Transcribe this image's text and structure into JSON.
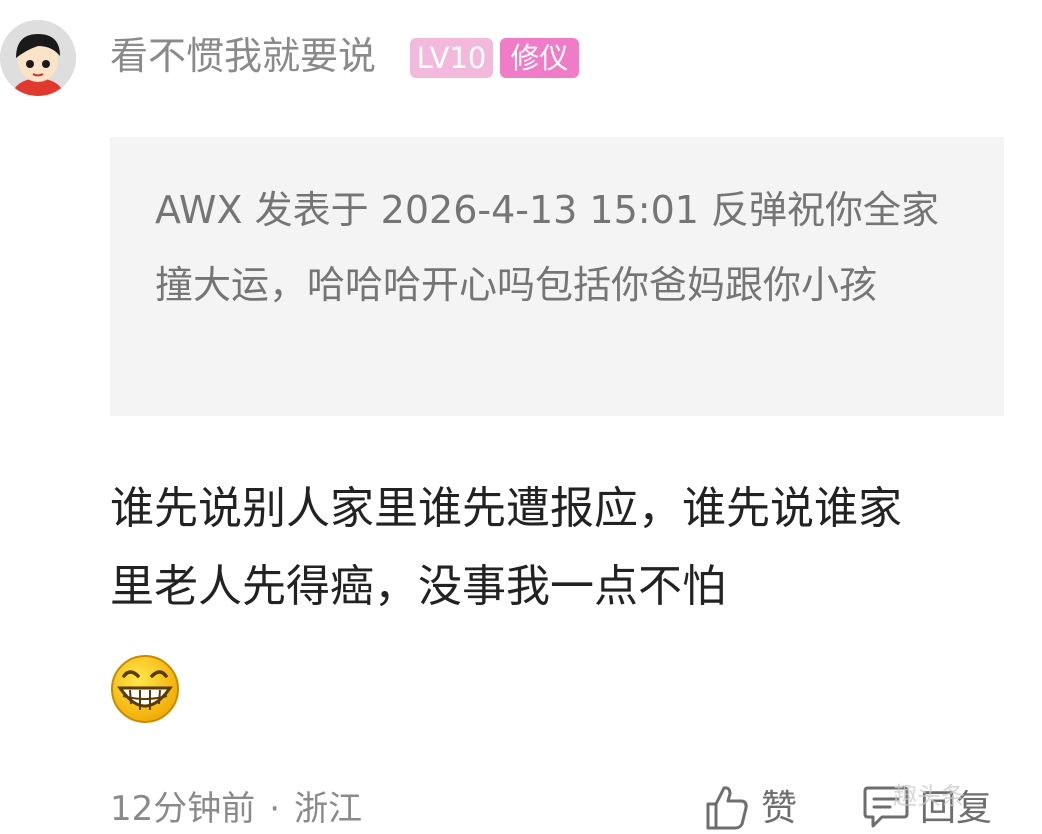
{
  "comment": {
    "username": "看不惯我就要说",
    "level_badge": "LV10",
    "title_badge": "修仪",
    "quote": "AWX 发表于 2026-4-13 15:01 反弹祝你全家撞大运，哈哈哈开心吗包括你爸妈跟你小孩",
    "body": "谁先说别人家里谁先遭报应，谁先说谁家里老人先得癌，没事我一点不怕",
    "emoji": "grinning-face-emoji",
    "time": "12分钟前",
    "separator": "·",
    "location": "浙江"
  },
  "actions": {
    "like_label": "赞",
    "like_icon": "thumbs-up-icon",
    "reply_label": "回复",
    "reply_icon": "comment-icon"
  },
  "watermark": {
    "text": "趣头条"
  },
  "colors": {
    "level_badge": "#f3b9dd",
    "title_badge": "#f07bc7",
    "quote_bg": "#f4f4f4",
    "meta_text": "#8a8a8a"
  }
}
